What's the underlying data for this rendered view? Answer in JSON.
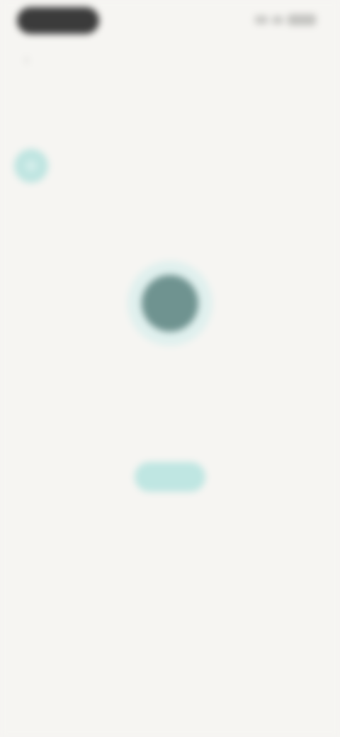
{
  "status_bar": {
    "time": "",
    "signal_icon": "signal-icon",
    "wifi_icon": "wifi-icon",
    "battery_icon": "battery-icon"
  },
  "nav": {
    "back_icon": "chevron-left-icon",
    "back_glyph": "‹",
    "title": "",
    "action_label": ""
  },
  "section": {
    "heading": ""
  },
  "member": {
    "name": "",
    "avatar_color": "#bfe5e1"
  },
  "empty_state": {
    "icon": "placeholder-icon",
    "title": "",
    "description": "",
    "button_label": ""
  },
  "colors": {
    "background": "#f6f5f2",
    "accent": "#bfe6e2",
    "icon_dark": "#6f9390"
  }
}
